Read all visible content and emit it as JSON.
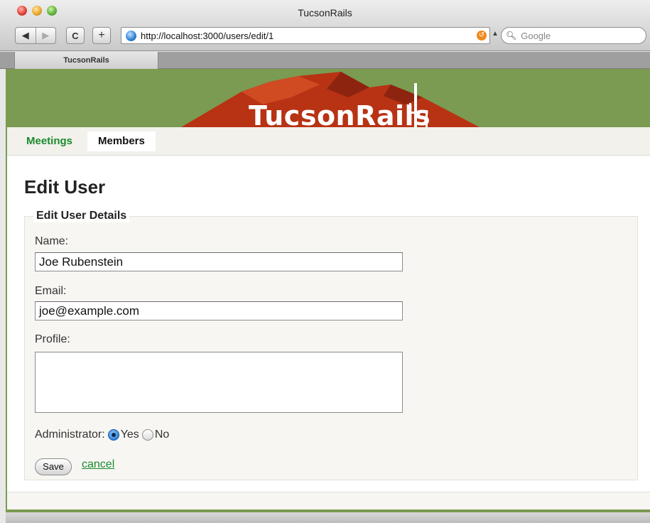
{
  "window": {
    "title": "TucsonRails"
  },
  "toolbar": {
    "back_glyph": "◀",
    "forward_glyph": "▶",
    "reload_glyph": "C",
    "add_glyph": "+",
    "url": "http://localhost:3000/users/edit/1",
    "search_placeholder": "Google"
  },
  "tabs": [
    {
      "label": "TucsonRails"
    }
  ],
  "site": {
    "logo_text": "TucsonRails"
  },
  "nav": {
    "items": [
      {
        "label": "Meetings",
        "active": false
      },
      {
        "label": "Members",
        "active": true
      }
    ]
  },
  "main": {
    "heading": "Edit User",
    "fieldset_legend": "Edit User Details",
    "fields": {
      "name_label": "Name:",
      "name_value": "Joe Rubenstein",
      "email_label": "Email:",
      "email_value": "joe@example.com",
      "profile_label": "Profile:",
      "profile_value": ""
    },
    "admin": {
      "label": "Administrator:",
      "options": [
        "Yes",
        "No"
      ],
      "selected": "Yes"
    },
    "save_label": "Save",
    "cancel_label": "cancel"
  },
  "colors": {
    "banner_green": "#7a9b51",
    "nav_link_green": "#1b8a2e",
    "mountain_red": "#b83214"
  },
  "icons": [
    "back-arrow-icon",
    "forward-arrow-icon",
    "reload-icon",
    "add-bookmark-icon",
    "globe-icon",
    "snapback-icon",
    "search-icon",
    "cactus-icon"
  ]
}
